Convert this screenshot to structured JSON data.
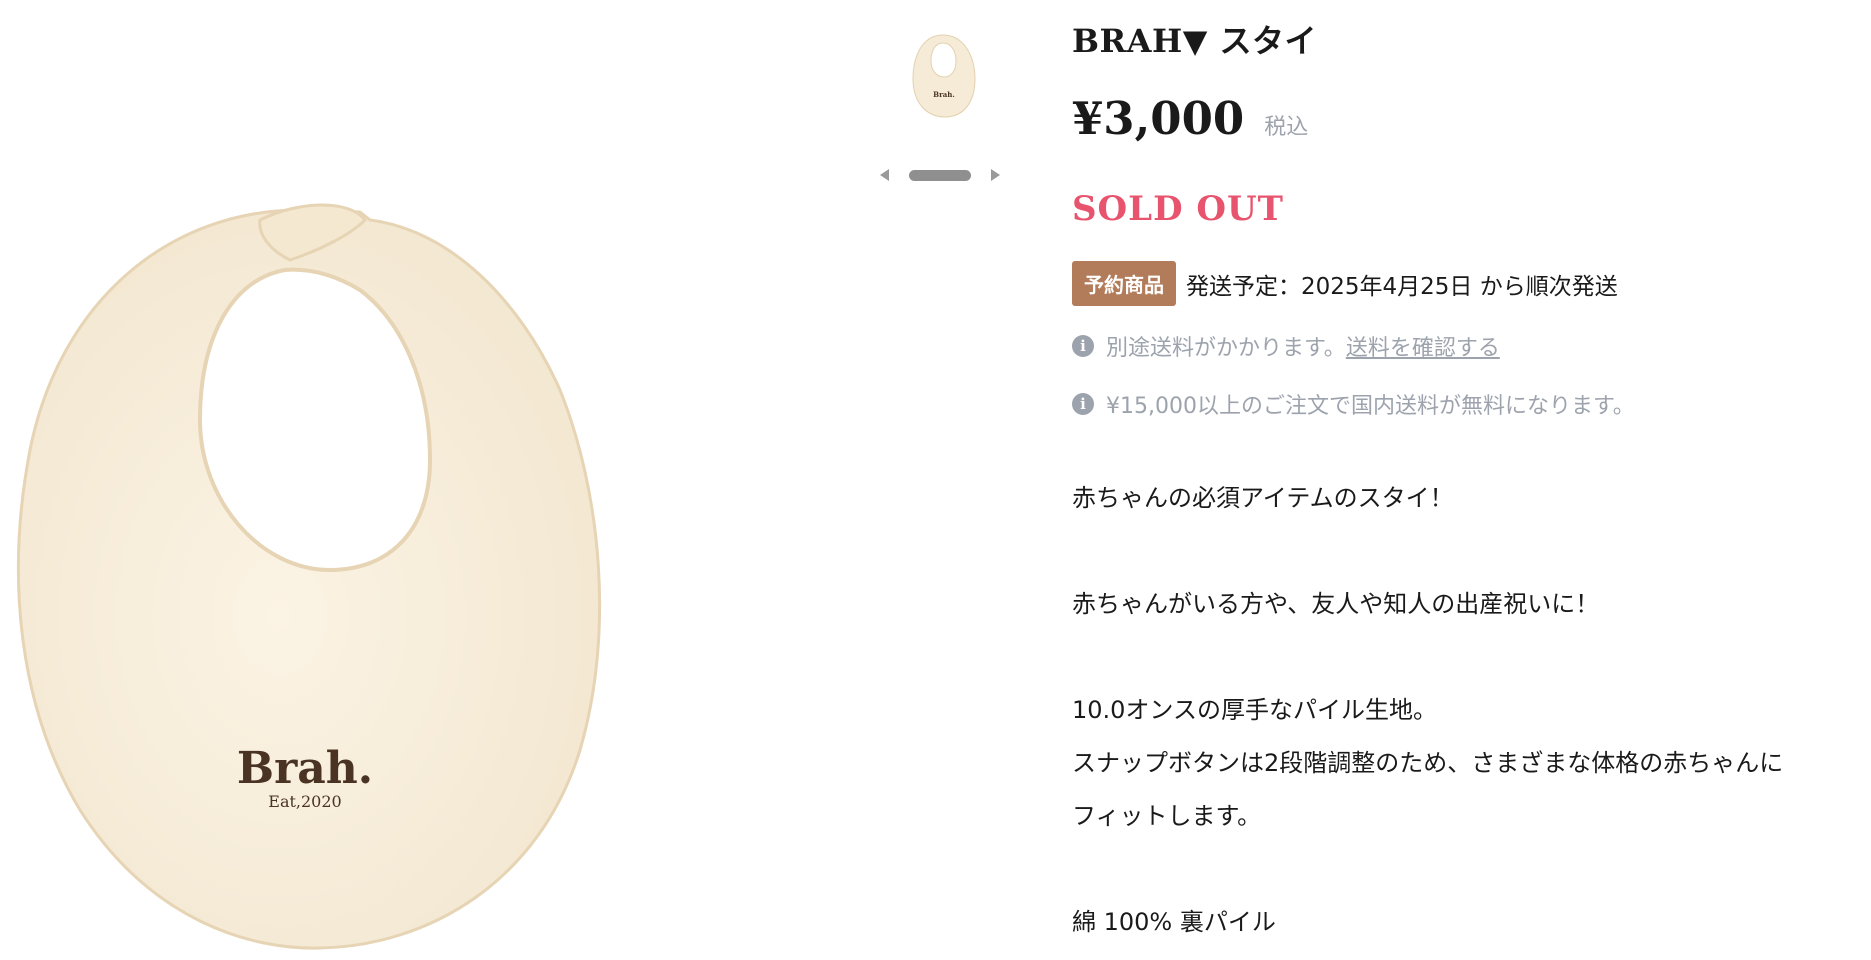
{
  "product": {
    "title": "BRAH▼ スタイ",
    "price": "¥3,000",
    "tax_label": "税込",
    "status": "SOLD OUT",
    "reserve_badge": "予約商品",
    "shipping_schedule": "発送予定：2025年4月25日 から順次発送",
    "shipping_note": "別途送料がかかります。",
    "shipping_link": "送料を確認する",
    "free_shipping_note": "¥15,000以上のご注文で国内送料が無料になります。"
  },
  "image": {
    "logo_text": "Brah.",
    "logo_sub": "Eat,2020"
  },
  "description": {
    "line1": "赤ちゃんの必須アイテムのスタイ！",
    "line2": "赤ちゃんがいる方や、友人や知人の出産祝いに！",
    "line3": "10.0オンスの厚手なパイル生地。",
    "line4": "スナップボタンは2段階調整のため、さまざまな体格の赤ちゃんに",
    "line5": "フィットします。",
    "line6": "綿 100% 裏パイル"
  },
  "icons": {
    "info": "info-icon",
    "prev": "chevron-left-icon",
    "next": "chevron-right-icon"
  },
  "colors": {
    "sold_out": "#e8546e",
    "badge": "#b27b59",
    "muted": "#9da3ad",
    "bib": "#f7eedd"
  }
}
